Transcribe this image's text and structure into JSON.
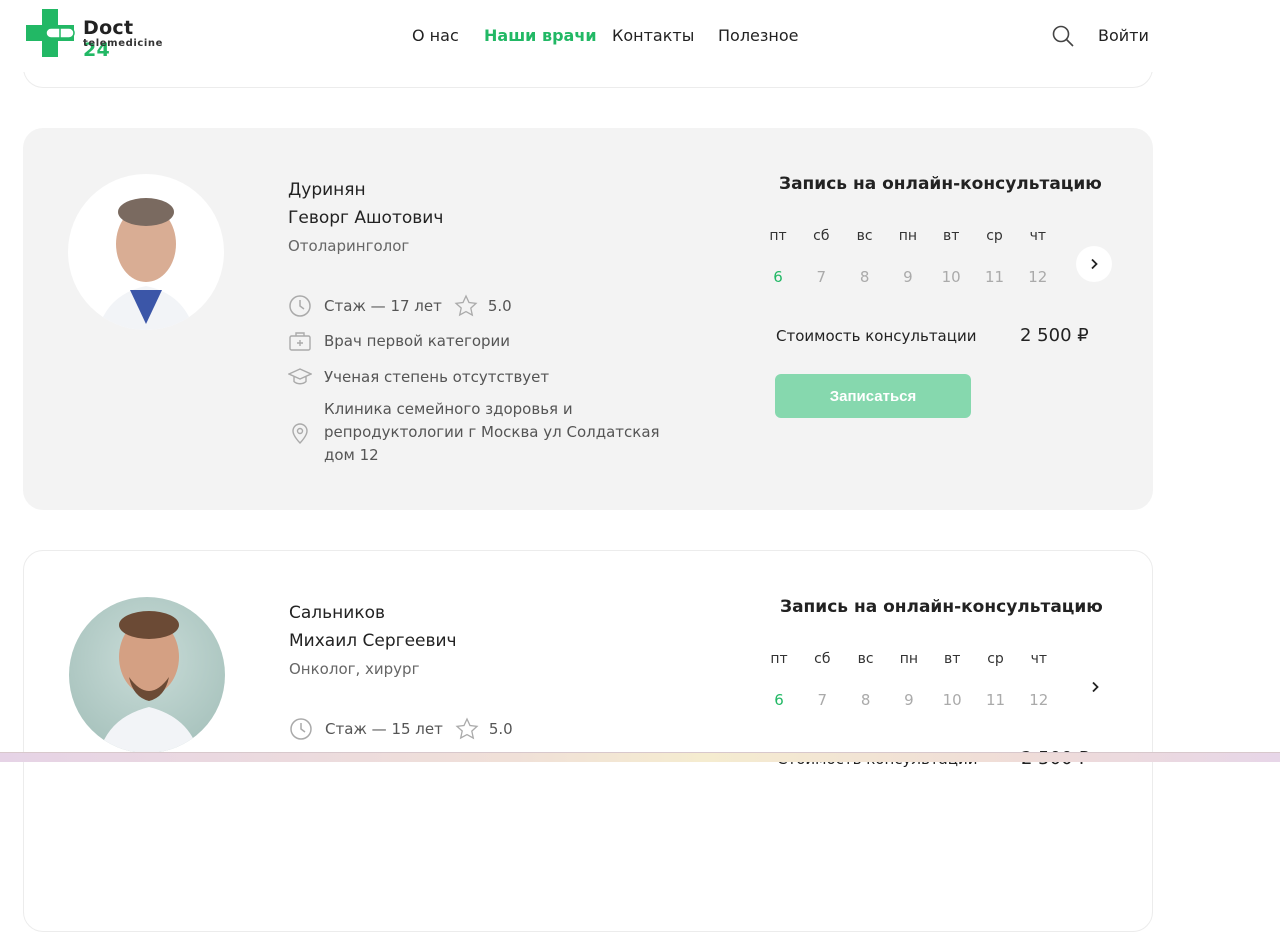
{
  "header": {
    "logo": {
      "brand": "Doct",
      "number": "24",
      "sub": "telemedicine"
    },
    "nav": [
      {
        "label": "О нас"
      },
      {
        "label": "Наши врачи",
        "active": true
      },
      {
        "label": "Контакты"
      },
      {
        "label": "Полезное"
      }
    ],
    "login_label": "Войти",
    "accent": "#22b865"
  },
  "doctors": [
    {
      "surname": "Дуринян",
      "given": "Геворг Ашотович",
      "specialty": "Отоларинголог",
      "experience": "Стаж — 17 лет",
      "rating": "5.0",
      "category": "Врач первой категории",
      "degree": "Ученая степень отсутствует",
      "clinic": "Клиника семейного здоровья и репродуктологии г Москва ул Солдатская дом 12",
      "booking_title": "Запись на онлайн-консультацию",
      "days": [
        {
          "n": "пт",
          "d": "6"
        },
        {
          "n": "сб",
          "d": "7"
        },
        {
          "n": "вс",
          "d": "8"
        },
        {
          "n": "пн",
          "d": "9"
        },
        {
          "n": "вт",
          "d": "10"
        },
        {
          "n": "ср",
          "d": "11"
        },
        {
          "n": "чт",
          "d": "12"
        }
      ],
      "price_label": "Стоимость консультации",
      "price": "2 500 ₽",
      "button": "Записаться"
    },
    {
      "surname": "Сальников",
      "given": "Михаил Сергеевич",
      "specialty": "Онколог, хирург",
      "experience": "Стаж — 15 лет",
      "rating": "5.0",
      "booking_title": "Запись на онлайн-консультацию",
      "days": [
        {
          "n": "пт",
          "d": "6"
        },
        {
          "n": "сб",
          "d": "7"
        },
        {
          "n": "вс",
          "d": "8"
        },
        {
          "n": "пн",
          "d": "9"
        },
        {
          "n": "вт",
          "d": "10"
        },
        {
          "n": "ср",
          "d": "11"
        },
        {
          "n": "чт",
          "d": "12"
        }
      ],
      "price_label": "Стоимость консультации",
      "price": "2 500 ₽"
    }
  ]
}
